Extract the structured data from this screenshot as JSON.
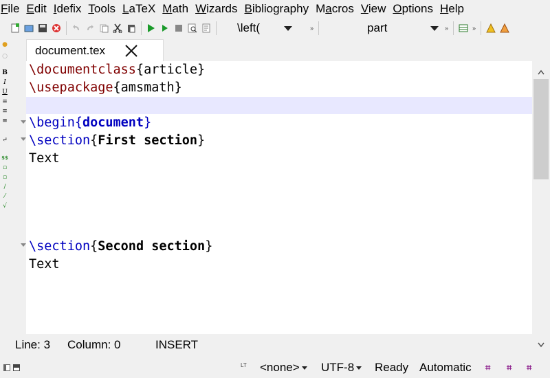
{
  "menu": [
    "File",
    "Edit",
    "Idefix",
    "Tools",
    "LaTeX",
    "Math",
    "Wizards",
    "Bibliography",
    "Macros",
    "View",
    "Options",
    "Help"
  ],
  "menu_mnemonics": [
    "F",
    "E",
    "I",
    "T",
    "L",
    "M",
    "W",
    "B",
    "a",
    "V",
    "O",
    "H"
  ],
  "toolbar": {
    "left_combo": "\\left(",
    "structure_combo": "part",
    "more_glyph": "»"
  },
  "tab": {
    "label": "document.tex"
  },
  "editor": {
    "lines": [
      {
        "parts": [
          {
            "t": "\\documentclass",
            "c": "cmd"
          },
          {
            "t": "{article}",
            "c": ""
          }
        ]
      },
      {
        "parts": [
          {
            "t": "\\usepackage",
            "c": "cmd"
          },
          {
            "t": "{amsmath}",
            "c": ""
          }
        ]
      },
      {
        "parts": []
      },
      {
        "parts": [
          {
            "t": "\\begin",
            "c": "envcmd"
          },
          {
            "t": "{",
            "c": "envcmd"
          },
          {
            "t": "document",
            "c": "env"
          },
          {
            "t": "}",
            "c": "envcmd"
          }
        ]
      },
      {
        "parts": [
          {
            "t": "\\section",
            "c": "sec"
          },
          {
            "t": "{",
            "c": ""
          },
          {
            "t": "First section",
            "c": "bold"
          },
          {
            "t": "}",
            "c": ""
          }
        ]
      },
      {
        "parts": [
          {
            "t": "Text",
            "c": ""
          }
        ]
      },
      {
        "parts": []
      },
      {
        "parts": []
      },
      {
        "parts": []
      },
      {
        "parts": []
      },
      {
        "parts": [
          {
            "t": "\\section",
            "c": "sec"
          },
          {
            "t": "{",
            "c": ""
          },
          {
            "t": "Second section",
            "c": "bold"
          },
          {
            "t": "}",
            "c": ""
          }
        ]
      },
      {
        "parts": [
          {
            "t": "Text",
            "c": ""
          }
        ]
      }
    ]
  },
  "position": {
    "line_label": "Line: 3",
    "column_label": "Column: 0",
    "mode": "INSERT"
  },
  "status": {
    "lt_label": "LT",
    "spell": "<none>",
    "encoding": "UTF-8",
    "state": "Ready",
    "mode": "Automatic"
  },
  "colors": {
    "command": "#800000",
    "environment": "#0000c0",
    "current_line": "#e8e8ff",
    "accent_magenta": "#8a1a8a"
  }
}
